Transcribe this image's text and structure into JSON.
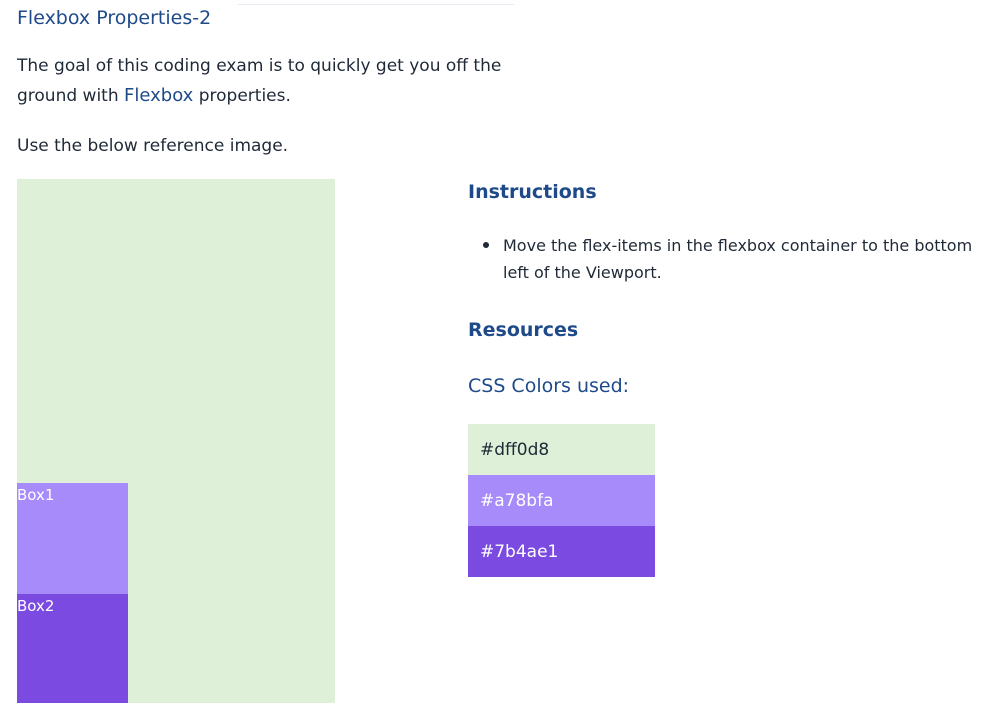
{
  "page": {
    "title": "Flexbox Properties-2",
    "intro": {
      "line1": "The goal of this coding exam is to quickly get you off the",
      "line2_prefix": "ground with ",
      "line2_highlight": "Flexbox",
      "line2_suffix": " properties."
    },
    "reference_text": "Use the below reference image."
  },
  "reference_image": {
    "background_color": "#dff0d8",
    "boxes": [
      {
        "label": "Box1",
        "color": "#a78bfa"
      },
      {
        "label": "Box2",
        "color": "#7b4ae1"
      }
    ]
  },
  "instructions": {
    "heading": "Instructions",
    "items": [
      {
        "line1": "Move the flex-items in the flexbox container to the bottom",
        "line2": "left of the Viewport."
      }
    ]
  },
  "resources": {
    "heading": "Resources",
    "colors_heading": "CSS Colors used:",
    "colors": [
      {
        "label": "#dff0d8",
        "hex": "#dff0d8"
      },
      {
        "label": "#a78bfa",
        "hex": "#a78bfa"
      },
      {
        "label": "#7b4ae1",
        "hex": "#7b4ae1"
      }
    ]
  }
}
